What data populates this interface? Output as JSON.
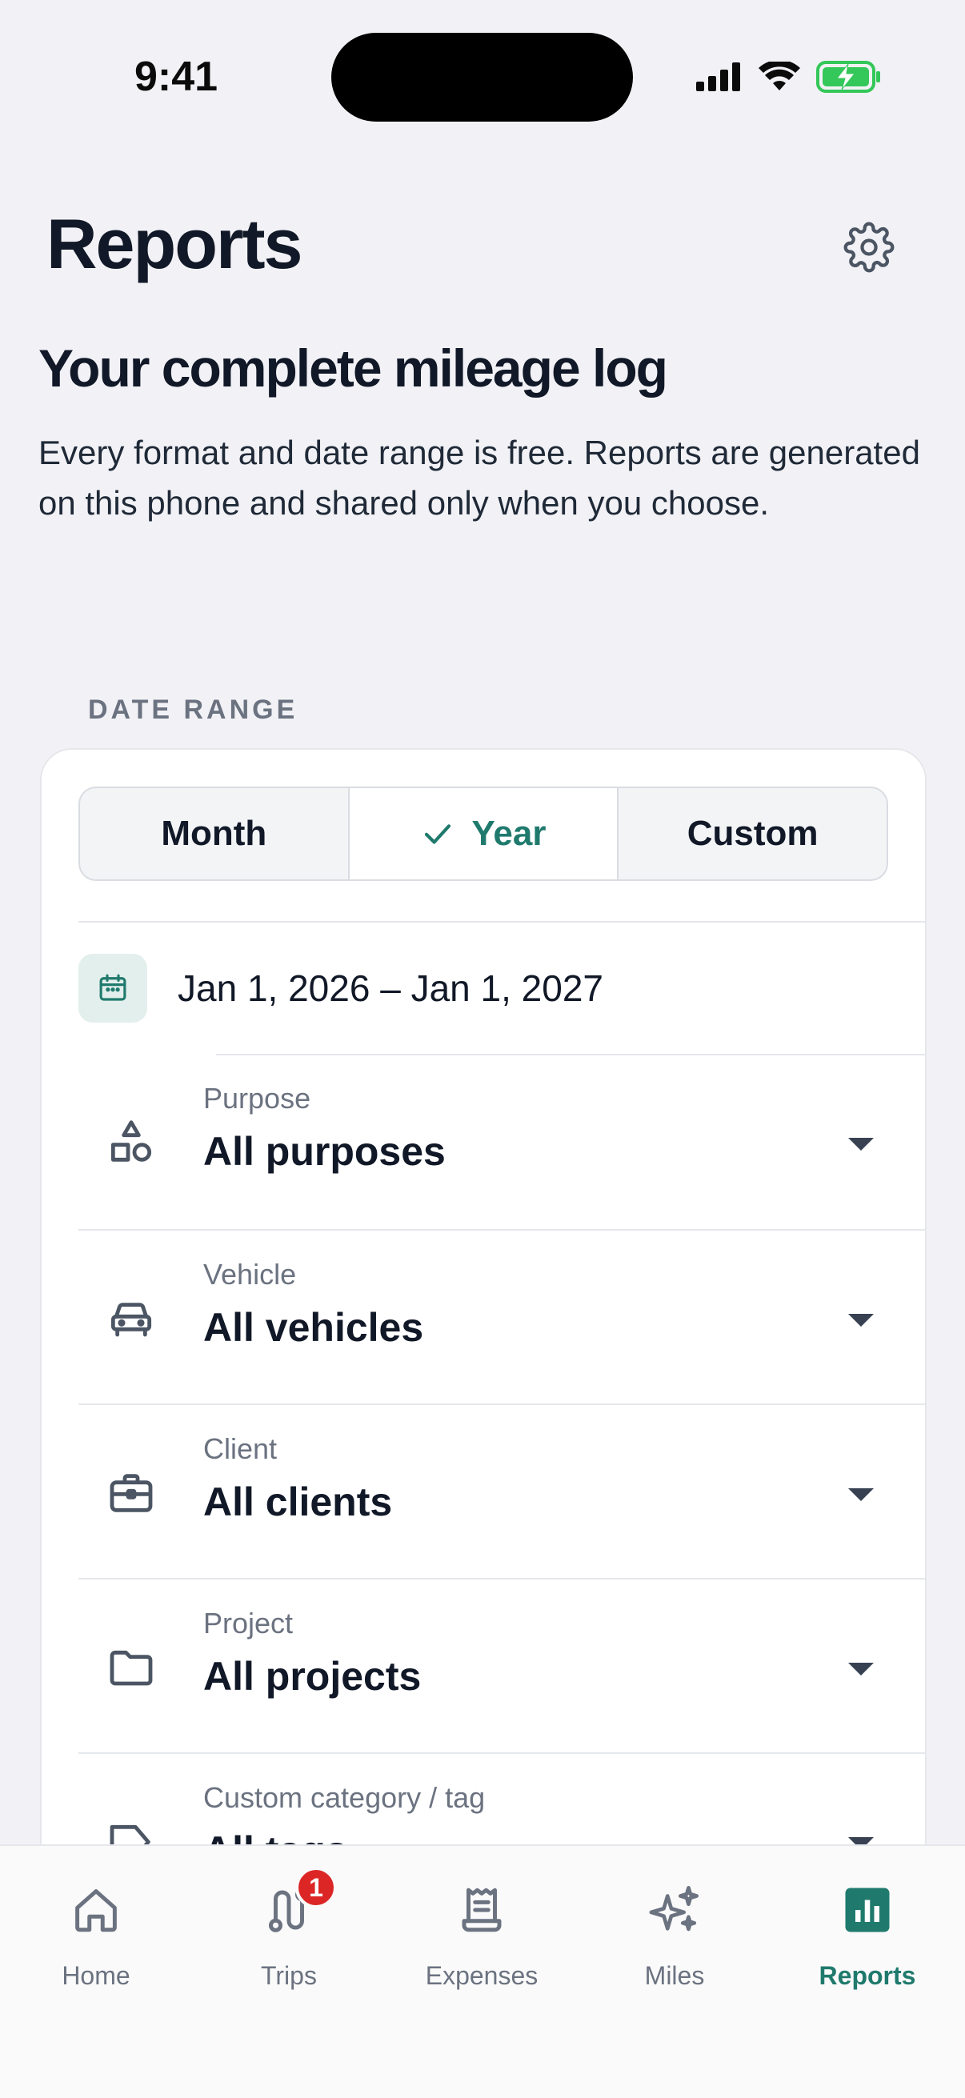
{
  "status_bar": {
    "time": "9:41"
  },
  "header": {
    "title": "Reports"
  },
  "hero": {
    "title": "Your complete mileage log",
    "description": "Every format and date range is free. Reports are generated on this phone and shared only when you choose."
  },
  "date_range": {
    "section_label": "DATE RANGE",
    "segments": [
      "Month",
      "Year",
      "Custom"
    ],
    "selected": "Year",
    "range_text": "Jan 1, 2026 – Jan 1, 2027"
  },
  "filters": [
    {
      "label": "Purpose",
      "value": "All purposes",
      "icon": "shapes-icon"
    },
    {
      "label": "Vehicle",
      "value": "All vehicles",
      "icon": "car-icon"
    },
    {
      "label": "Client",
      "value": "All clients",
      "icon": "briefcase-icon"
    },
    {
      "label": "Project",
      "value": "All projects",
      "icon": "folder-icon"
    },
    {
      "label": "Custom category / tag",
      "value": "All tags",
      "icon": "tag-icon"
    }
  ],
  "tab_bar": {
    "tabs": [
      {
        "label": "Home",
        "icon": "home-icon"
      },
      {
        "label": "Trips",
        "icon": "route-icon",
        "badge": "1"
      },
      {
        "label": "Expenses",
        "icon": "receipt-icon"
      },
      {
        "label": "Miles",
        "icon": "sparkles-icon"
      },
      {
        "label": "Reports",
        "icon": "bar-chart-icon",
        "active": true
      }
    ]
  },
  "colors": {
    "accent": "#1f7a6d",
    "badge": "#dc2626",
    "battery": "#34c759"
  }
}
